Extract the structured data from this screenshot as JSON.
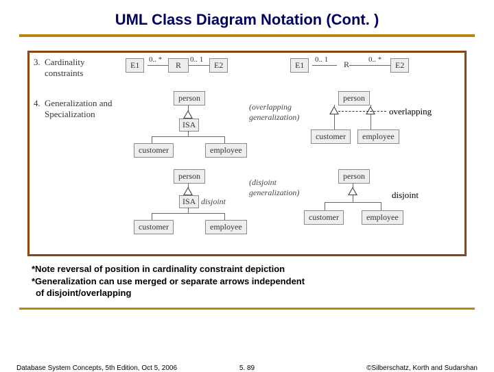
{
  "title": "UML Class Diagram Notation (Cont. )",
  "section3": {
    "num": "3.",
    "label": "Cardinality\nconstraints"
  },
  "section4": {
    "num": "4.",
    "label": "Generalization and\nSpecialization"
  },
  "row3a": {
    "e1": "E1",
    "r": "R",
    "e2": "E2",
    "c1": "0.. *",
    "c2": "0.. 1"
  },
  "row3b": {
    "e1": "E1",
    "r": "R",
    "e2": "E2",
    "c1": "0.. 1",
    "c2": "0.. *"
  },
  "hier_left1": {
    "top": "person",
    "isa": "ISA",
    "l": "customer",
    "r": "employee"
  },
  "hier_right1": {
    "top": "person",
    "l": "customer",
    "r": "employee",
    "caption": "(overlapping\ngeneralization)"
  },
  "hier_left2": {
    "top": "person",
    "isa": "ISA",
    "disj": "disjoint",
    "l": "customer",
    "r": "employee"
  },
  "hier_right2": {
    "top": "person",
    "l": "customer",
    "r": "employee",
    "caption": "(disjoint\ngeneralization)"
  },
  "annot": {
    "overlapping": "overlapping",
    "disjoint": "disjoint"
  },
  "notes": {
    "line1": "*Note reversal of position in cardinality constraint depiction",
    "line2": "*Generalization can use merged or separate arrows independent",
    "line3": "  of disjoint/overlapping"
  },
  "footer": {
    "left": "Database System Concepts, 5th Edition, Oct 5, 2006",
    "mid": "5. 89",
    "right": "©Silberschatz, Korth and Sudarshan"
  }
}
